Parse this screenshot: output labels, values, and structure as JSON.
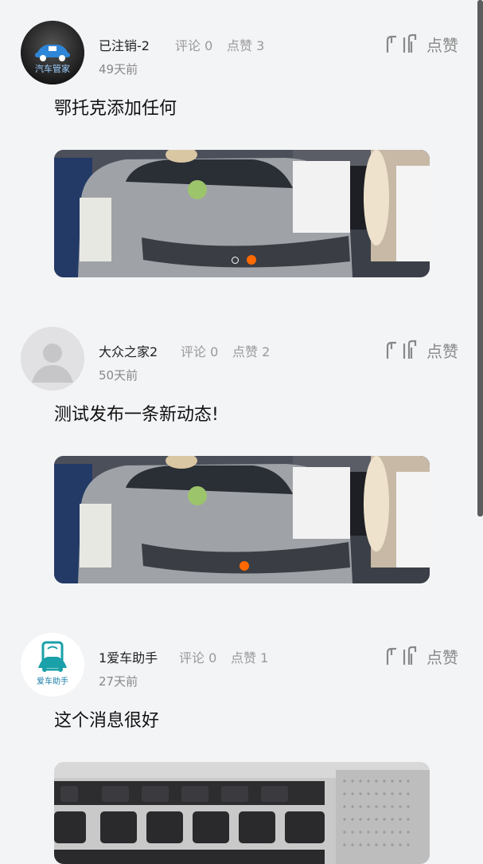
{
  "posts": [
    {
      "user": "已注销-2",
      "comments": "评论 0",
      "likes": "点赞 3",
      "time": "49天前",
      "like_button": "点赞",
      "content": "鄂托克添加任何",
      "avatar_icon": "car-logo-icon",
      "avatar_text": "汽车管家",
      "photo": "car-show-photo"
    },
    {
      "user": "大众之家2",
      "comments": "评论 0",
      "likes": "点赞 2",
      "time": "50天前",
      "like_button": "点赞",
      "content": "测试发布一条新动态!",
      "avatar_icon": "default-user-icon",
      "photo": "car-show-photo"
    },
    {
      "user": "1爱车助手",
      "comments": "评论 0",
      "likes": "点赞 1",
      "time": "27天前",
      "like_button": "点赞",
      "content": "这个消息很好",
      "avatar_icon": "car-assistant-logo-icon",
      "avatar_text": "爱车助手",
      "photo": "keyboard-photo"
    }
  ],
  "colors": {
    "accent": "#ff6a00",
    "background": "#f3f4f6",
    "muted": "#999999"
  }
}
